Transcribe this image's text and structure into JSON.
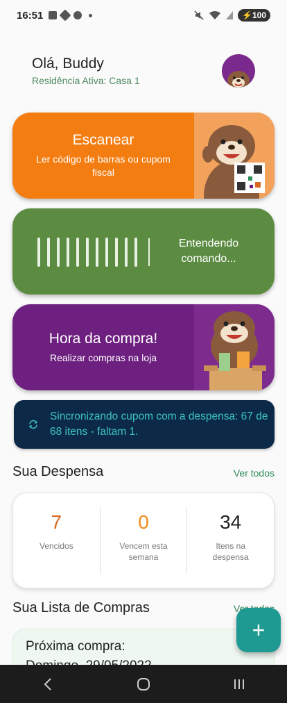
{
  "status_bar": {
    "time": "16:51",
    "battery": "100"
  },
  "header": {
    "greeting": "Olá, Buddy",
    "residence": "Residência Ativa: Casa 1"
  },
  "cards": {
    "scan": {
      "title": "Escanear",
      "subtitle": "Ler código de barras ou cupom fiscal"
    },
    "voice": {
      "status": "Entendendo comando..."
    },
    "shop": {
      "title": "Hora da compra!",
      "subtitle": "Realizar compras na loja"
    }
  },
  "sync": {
    "message": "Sincronizando cupom com a despensa: 67 de 68 itens - faltam 1."
  },
  "pantry": {
    "title": "Sua Despensa",
    "see_all": "Ver todos",
    "stats": [
      {
        "value": "7",
        "label": "Vencidos",
        "color": "#d9661f"
      },
      {
        "value": "0",
        "label": "Vencem esta semana",
        "color": "#f08c1a"
      },
      {
        "value": "34",
        "label": "Itens na despensa",
        "color": "#222222"
      }
    ]
  },
  "shopping_list": {
    "title": "Sua Lista de Compras",
    "see_all": "Ver todos",
    "next_title": "Próxima compra:",
    "next_date": "Domingo, 29/05/2022"
  },
  "fab": {
    "label": "+"
  },
  "colors": {
    "scan": "#f47d12",
    "voice": "#5c8c42",
    "shop": "#6e2080",
    "sync_bg": "#0c2a48",
    "sync_text": "#3dc4c4",
    "accent": "#1e9a93"
  }
}
